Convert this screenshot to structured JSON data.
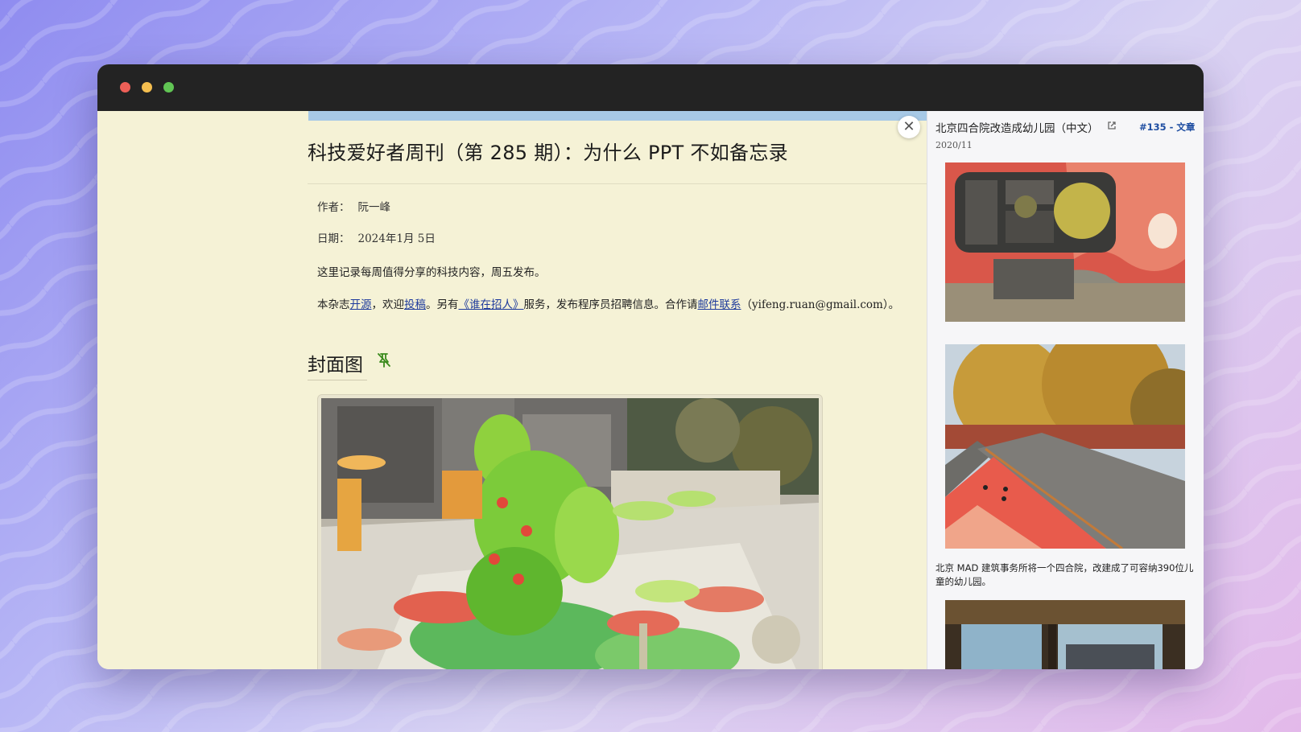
{
  "article": {
    "title": "科技爱好者周刊（第 285 期）：为什么 PPT 不如备忘录",
    "author_label": "作者：",
    "author": "阮一峰",
    "date_label": "日期：",
    "date": "2024年1月 5日",
    "intro": "这里记录每周值得分享的科技内容，周五发布。",
    "p2": {
      "t1": "本杂志",
      "link_open_source": "开源",
      "t2": "，欢迎",
      "link_submit": "投稿",
      "t3": "。另有",
      "link_hiring": "《谁在招人》",
      "t4": "服务，发布程序员招聘信息。合作请",
      "link_mail": "邮件联系",
      "t5": "（yifeng.ruan@gmail.com）。"
    },
    "section_heading": "封面图",
    "section_icon": "pin-off-icon"
  },
  "close_icon": "close-icon",
  "sidebar": {
    "title": "北京四合院改造成幼儿园（中文）",
    "external_icon": "external-link-icon",
    "tag": "#135 - 文章",
    "date": "2020/11",
    "caption": "北京 MAD 建筑事务所将一个四合院，改建成了可容纳390位儿童的幼儿园。"
  },
  "colors": {
    "window_chrome": "#232323",
    "article_bg": "#f5f2d6",
    "sidebar_bg": "#f6f6f8",
    "link": "#1d3a9c",
    "tag": "#1e4da1",
    "icon_green": "#3a8a1c"
  }
}
